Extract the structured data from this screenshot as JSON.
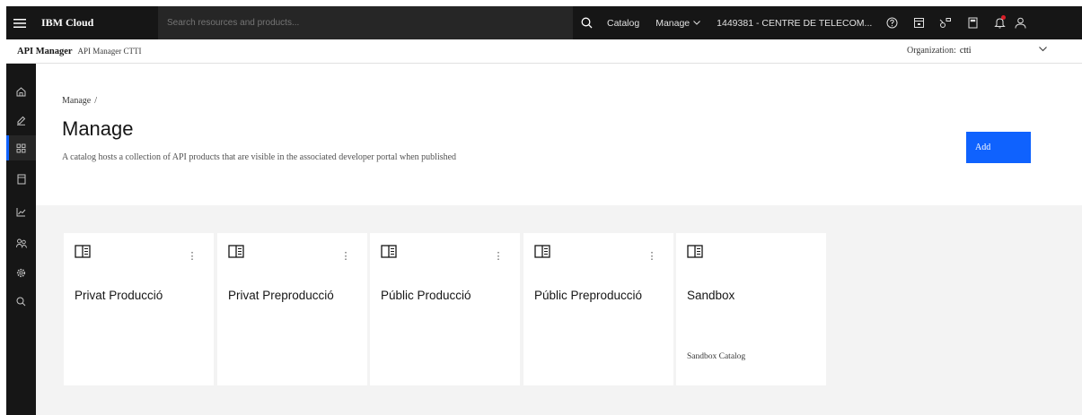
{
  "topbar": {
    "brand": "IBM Cloud",
    "search_placeholder": "Search resources and products...",
    "links": {
      "catalog": "Catalog",
      "manage": "Manage",
      "account": "1449381 - CENTRE DE TELECOM..."
    },
    "icons": [
      "help-icon",
      "cost-estimator-icon",
      "switcher-icon",
      "calculator-icon",
      "notification-icon",
      "user-avatar-icon"
    ]
  },
  "subheader": {
    "title": "API Manager",
    "subtitle": "API Manager CTTI",
    "org_label": "Organization:",
    "org_value": "ctti"
  },
  "sidebar": {
    "items": [
      "home-icon",
      "edit-icon",
      "manage-icon",
      "drafts-icon",
      "analytics-icon",
      "members-icon",
      "settings-icon",
      "search-icon"
    ],
    "active": "manage-icon"
  },
  "page": {
    "breadcrumb": "Manage",
    "breadcrumb_sep": "/",
    "title": "Manage",
    "description": "A catalog hosts a collection of API products that are visible in the associated developer portal when published",
    "add_label": "Add"
  },
  "catalogs": [
    {
      "title": "Privat Producció",
      "description": "",
      "has_menu": true
    },
    {
      "title": "Privat Preproducció",
      "description": "",
      "has_menu": true
    },
    {
      "title": "Públic Producció",
      "description": "",
      "has_menu": true
    },
    {
      "title": "Públic Preproducció",
      "description": "",
      "has_menu": true
    },
    {
      "title": "Sandbox",
      "description": "Sandbox Catalog",
      "has_menu": false
    }
  ],
  "colors": {
    "topbar_bg": "#161616",
    "accent": "#0f62fe",
    "content_bg": "#f3f3f3",
    "notification": "#da1e28"
  }
}
